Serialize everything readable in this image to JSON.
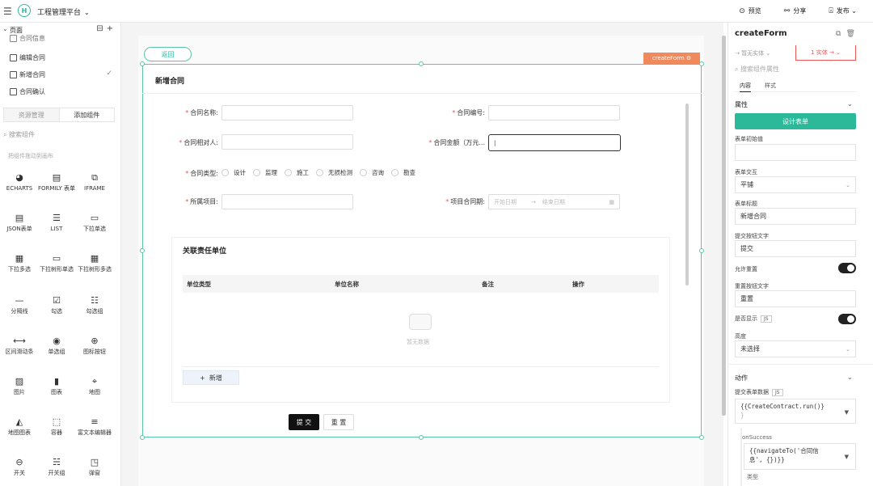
{
  "topbar": {
    "app_title": "工程管理平台",
    "logo_glyph": "H",
    "preview": "预览",
    "share": "分享",
    "publish": "发布"
  },
  "left": {
    "pages_label": "页面",
    "pages": [
      {
        "label": "合同信息"
      },
      {
        "label": "编辑合同"
      },
      {
        "label": "新增合同",
        "checked": true
      },
      {
        "label": "合同确认"
      }
    ],
    "tab_resources": "资源管理",
    "tab_add_component": "添加组件",
    "search_placeholder": "搜索组件",
    "drag_hint": "把组件拖动到画布",
    "components": [
      {
        "label": "ECHARTS",
        "icon": "echarts-icon",
        "glyph": "◕"
      },
      {
        "label": "FORMILY 表单",
        "icon": "form-icon",
        "glyph": "▤"
      },
      {
        "label": "IFRAME",
        "icon": "iframe-icon",
        "glyph": "⧉"
      },
      {
        "label": "JSON表单",
        "icon": "json-form-icon",
        "glyph": "▤"
      },
      {
        "label": "LIST",
        "icon": "list-icon",
        "glyph": "☰"
      },
      {
        "label": "下拉单选",
        "icon": "dropdown-icon",
        "glyph": "▭"
      },
      {
        "label": "下拉多选",
        "icon": "multi-dropdown-icon",
        "glyph": "▦"
      },
      {
        "label": "下拉树形单选",
        "icon": "tree-select-icon",
        "glyph": "▭"
      },
      {
        "label": "下拉树形多选",
        "icon": "tree-multi-select-icon",
        "glyph": "▦"
      },
      {
        "label": "分隔线",
        "icon": "divider-icon",
        "glyph": "—"
      },
      {
        "label": "勾选",
        "icon": "checkbox-icon",
        "glyph": "☑"
      },
      {
        "label": "勾选组",
        "icon": "checkbox-group-icon",
        "glyph": "☷"
      },
      {
        "label": "区间滑动条",
        "icon": "range-slider-icon",
        "glyph": "⟷"
      },
      {
        "label": "单选组",
        "icon": "radio-group-icon",
        "glyph": "◉"
      },
      {
        "label": "图标按钮",
        "icon": "icon-button-icon",
        "glyph": "⊕"
      },
      {
        "label": "图片",
        "icon": "image-icon",
        "glyph": "▨"
      },
      {
        "label": "图表",
        "icon": "chart-icon",
        "glyph": "▮"
      },
      {
        "label": "地图",
        "icon": "map-icon",
        "glyph": "⌖"
      },
      {
        "label": "地图图表",
        "icon": "map-chart-icon",
        "glyph": "◭"
      },
      {
        "label": "容器",
        "icon": "container-icon",
        "glyph": "⬚"
      },
      {
        "label": "富文本编辑器",
        "icon": "rich-text-icon",
        "glyph": "≡"
      },
      {
        "label": "开关",
        "icon": "switch-icon",
        "glyph": "⊖"
      },
      {
        "label": "开关组",
        "icon": "switch-group-icon",
        "glyph": "☵"
      },
      {
        "label": "弹窗",
        "icon": "modal-icon",
        "glyph": "◳"
      }
    ]
  },
  "canvas": {
    "back_button": "返回",
    "selection_tag": "createForm",
    "form_title": "新增合同",
    "fields": {
      "contract_name": "合同名称:",
      "contract_no": "合同编号:",
      "counterparty": "合同相对人:",
      "amount": "合同金额（万元...",
      "type": "合同类型:",
      "project": "所属项目:",
      "period": "项目合同期:"
    },
    "date_start_placeholder": "开始日期",
    "date_end_placeholder": "结束日期",
    "type_options": [
      "设计",
      "监理",
      "施工",
      "无损检测",
      "咨询",
      "勘查"
    ],
    "sub_title": "关联责任单位",
    "table_headers": [
      "单位类型",
      "单位名称",
      "备注",
      "操作"
    ],
    "empty_text": "暂无数据",
    "add_button": "新增",
    "submit_button": "提 交",
    "reset_button": "重 置"
  },
  "right": {
    "component_name": "createForm",
    "instance_label": "暂无实体",
    "instance_count": "1 实体 →",
    "search_placeholder": "搜索组件属性",
    "tab_content": "内容",
    "tab_style": "样式",
    "props_section": "属性",
    "design_form_button": "设计表单",
    "initial_value_label": "表单初始值",
    "initial_value": "",
    "interaction_label": "表单交互",
    "interaction_value": "平铺",
    "form_title_label": "表单标题",
    "form_title_value": "新增合同",
    "submit_text_label": "提交按钮文字",
    "submit_text_value": "提交",
    "allow_reset_label": "允许重置",
    "allow_reset": true,
    "reset_text_label": "重置按钮文字",
    "reset_text_value": "重置",
    "visible_label": "是否显示",
    "visible": true,
    "js_badge": "JS",
    "height_label": "高度",
    "height_value": "未选择",
    "actions_section": "动作",
    "submit_data_label": "提交表单数据",
    "submit_code_line1": "{{CreateContract.run()}",
    "submit_code_line2": "}",
    "on_success_label": "onSuccess",
    "success_code_line1": "{{navigateTo('合同信",
    "success_code_line2": "息', {})}}",
    "type_label": "类型"
  },
  "colors": {
    "accent": "#2bb99a",
    "selection": "#f08a5d",
    "required": "#e55555"
  }
}
